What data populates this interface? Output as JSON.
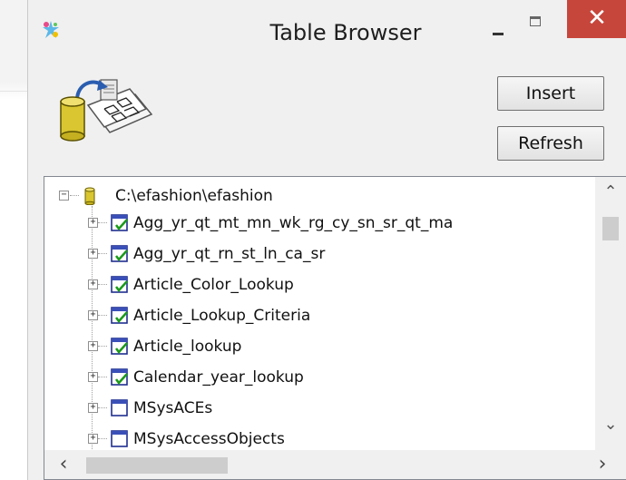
{
  "window": {
    "title": "Table Browser"
  },
  "buttons": {
    "insert_label": "Insert",
    "refresh_label": "Refresh"
  },
  "tree": {
    "root": {
      "label": "C:\\efashion\\efashion",
      "icon": "database-icon",
      "expander": "−"
    },
    "items": [
      {
        "label": "Agg_yr_qt_mt_mn_wk_rg_cy_sn_sr_qt_ma",
        "icon": "linked-table-icon",
        "expander": "+"
      },
      {
        "label": "Agg_yr_qt_rn_st_ln_ca_sr",
        "icon": "linked-table-icon",
        "expander": "+"
      },
      {
        "label": "Article_Color_Lookup",
        "icon": "linked-table-icon",
        "expander": "+"
      },
      {
        "label": "Article_Lookup_Criteria",
        "icon": "linked-table-icon",
        "expander": "+"
      },
      {
        "label": "Article_lookup",
        "icon": "linked-table-icon",
        "expander": "+"
      },
      {
        "label": "Calendar_year_lookup",
        "icon": "linked-table-icon",
        "expander": "+"
      },
      {
        "label": "MSysACEs",
        "icon": "system-table-icon",
        "expander": "+"
      },
      {
        "label": "MSysAccessObjects",
        "icon": "system-table-icon",
        "expander": "+"
      }
    ]
  },
  "colors": {
    "close_button": "#c7463b",
    "table_icon_border": "#1f2f8f",
    "check_green": "#1a9a1a",
    "db_yellow": "#d9c630"
  }
}
